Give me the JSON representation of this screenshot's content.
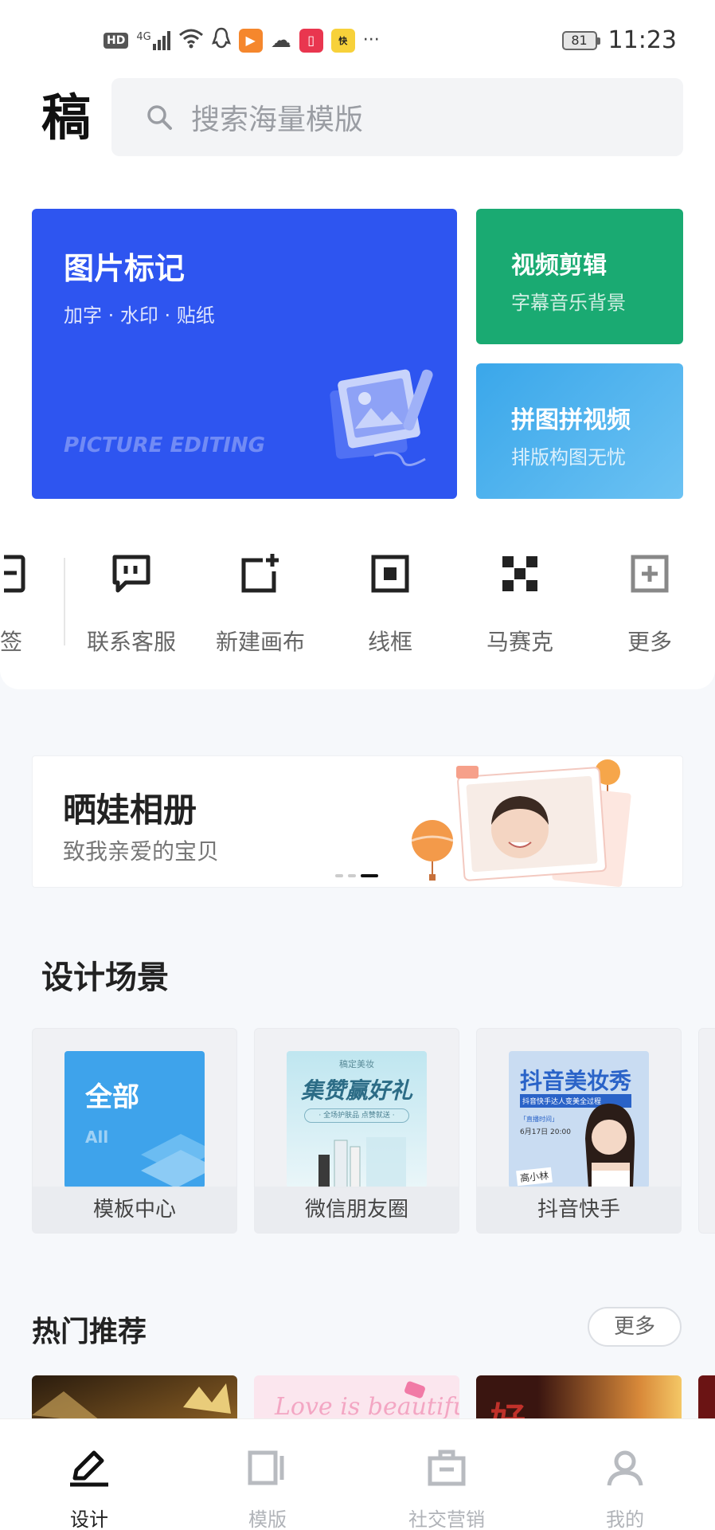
{
  "status_bar": {
    "hd": "HD",
    "signal": "4G",
    "battery": "81",
    "time": "11:23",
    "more": "···"
  },
  "header": {
    "logo": "稿",
    "search_placeholder": "搜索海量模版"
  },
  "features": {
    "main": {
      "title": "图片标记",
      "subtitle": "加字 · 水印 · 贴纸",
      "english": "PICTURE EDITING"
    },
    "video": {
      "title": "视频剪辑",
      "subtitle": "字幕音乐背景"
    },
    "collage": {
      "title": "拼图拼视频",
      "subtitle": "排版构图无忧"
    }
  },
  "tools": [
    {
      "label": "签",
      "icon": "signature-icon"
    },
    {
      "label": "联系客服",
      "icon": "chat-icon"
    },
    {
      "label": "新建画布",
      "icon": "new-canvas-icon"
    },
    {
      "label": "线框",
      "icon": "frame-icon"
    },
    {
      "label": "马赛克",
      "icon": "mosaic-icon"
    },
    {
      "label": "更多",
      "icon": "plus-square-icon"
    }
  ],
  "banner": {
    "title": "晒娃相册",
    "subtitle": "致我亲爱的宝贝"
  },
  "design_scenes": {
    "title": "设计场景",
    "items": [
      {
        "caption": "模板中心",
        "thumb_title": "全部",
        "thumb_sub": "All"
      },
      {
        "caption": "微信朋友圈",
        "thumb_small": "稿定美妆",
        "thumb_title": "集赞赢好礼",
        "thumb_tag": "· 全场护肤品 点赞就送 ·"
      },
      {
        "caption": "抖音快手",
        "thumb_title": "抖音美妆秀",
        "thumb_band": "抖音快手达人变美全过程",
        "thumb_small": "「直播时间」",
        "thumb_date": "6月17日 20:00",
        "thumb_name": "高小林"
      }
    ]
  },
  "hot": {
    "title": "热门推荐",
    "more": "更多",
    "card2_text": "Love is beautiful",
    "card3_text": "好"
  },
  "nav": [
    {
      "label": "设计",
      "icon": "pen-icon",
      "active": true
    },
    {
      "label": "模版",
      "icon": "template-icon",
      "active": false
    },
    {
      "label": "社交营销",
      "icon": "briefcase-icon",
      "active": false
    },
    {
      "label": "我的",
      "icon": "user-icon",
      "active": false
    }
  ],
  "colors": {
    "primary_blue": "#2e55f0",
    "green": "#1aaa72",
    "light_blue": "#3aa7ea"
  }
}
